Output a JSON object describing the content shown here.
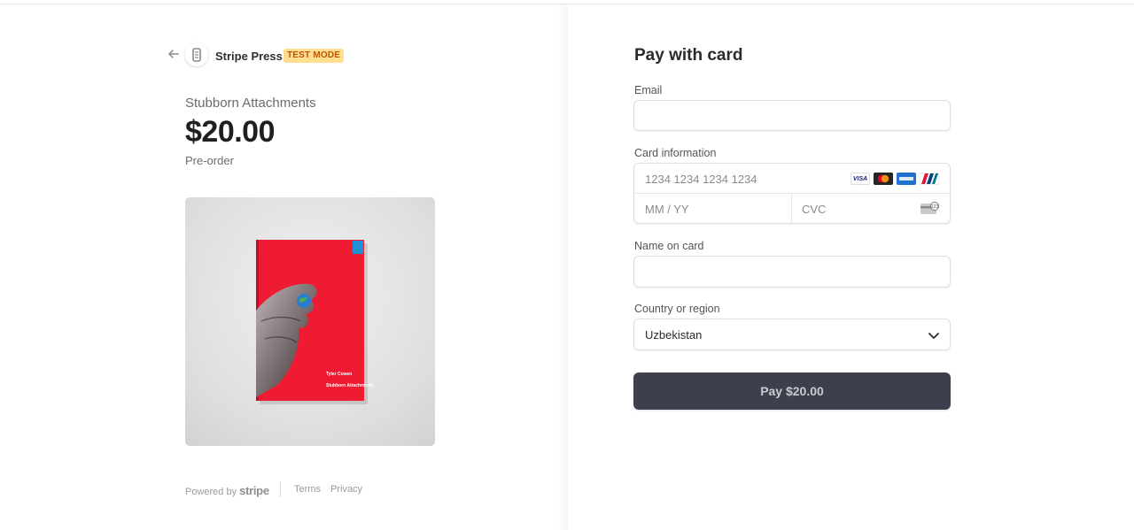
{
  "merchant": {
    "name": "Stripe Press",
    "badge": "TEST MODE"
  },
  "product": {
    "name": "Stubborn Attachments",
    "price": "$20.00",
    "note": "Pre-order",
    "cover": {
      "author": "Tyler Cowen",
      "title": "Stubborn Attachments",
      "color": "#ee1b32"
    }
  },
  "footer": {
    "powered_by": "Powered by",
    "stripe": "stripe",
    "terms": "Terms",
    "privacy": "Privacy"
  },
  "form": {
    "title": "Pay with card",
    "email": {
      "label": "Email",
      "value": "",
      "placeholder": ""
    },
    "card": {
      "label": "Card information",
      "number_placeholder": "1234 1234 1234 1234",
      "expiry_placeholder": "MM / YY",
      "cvc_placeholder": "CVC",
      "brands": [
        "visa",
        "mastercard",
        "amex",
        "unionpay"
      ]
    },
    "name": {
      "label": "Name on card",
      "value": "",
      "placeholder": ""
    },
    "country": {
      "label": "Country or region",
      "value": "Uzbekistan"
    },
    "pay_button": "Pay $20.00"
  },
  "colors": {
    "pay_button": "#3d404c",
    "badge_bg": "#ffde92",
    "badge_text": "#bb5504"
  }
}
